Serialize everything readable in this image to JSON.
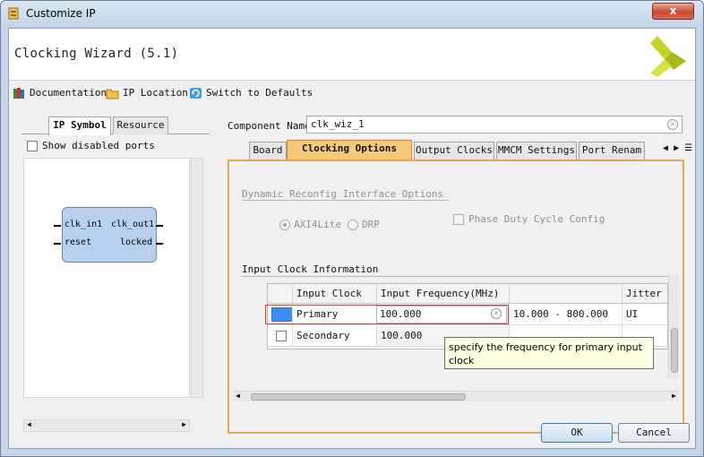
{
  "window": {
    "title": "Customize IP",
    "close_label": "x"
  },
  "header": {
    "title": "Clocking Wizard (5.1)"
  },
  "toolbar": {
    "documentation": "Documentation",
    "ip_location": "IP Location",
    "switch_defaults": "Switch to Defaults"
  },
  "left_panel": {
    "tabs": [
      "IP Symbol",
      "Resource"
    ],
    "show_disabled_ports": "Show disabled ports",
    "pins": {
      "clk_in1": "clk_in1",
      "reset": "reset",
      "clk_out1": "clk_out1",
      "locked": "locked"
    }
  },
  "component": {
    "label": "Component Name",
    "value": "clk_wiz_1"
  },
  "right_tabs": [
    "Board",
    "Clocking Options",
    "Output Clocks",
    "MMCM Settings",
    "Port Renam"
  ],
  "clocking": {
    "dynamic_section": "Dynamic Reconfig Interface Options",
    "radio_axi": "AXI4Lite",
    "radio_drp": "DRP",
    "phase_duty": "Phase Duty Cycle Config",
    "input_section": "Input Clock Information",
    "table": {
      "headers": [
        "Input Clock",
        "Input Frequency(MHz)",
        "",
        "Jitter O"
      ],
      "rows": [
        {
          "name": "Primary",
          "freq": "100.000",
          "range": "10.000 - 800.000",
          "jitter": "UI"
        },
        {
          "name": "Secondary",
          "freq": "100.000",
          "range": "",
          "jitter": ""
        }
      ]
    },
    "tooltip": "specify the frequency for primary input clock"
  },
  "buttons": {
    "ok": "OK",
    "cancel": "Cancel"
  },
  "colors": {
    "active_tab": "#f6c97a",
    "selection": "#3b8ff0",
    "highlight": "#d43c3c",
    "tooltip_bg": "#ffffe1"
  }
}
